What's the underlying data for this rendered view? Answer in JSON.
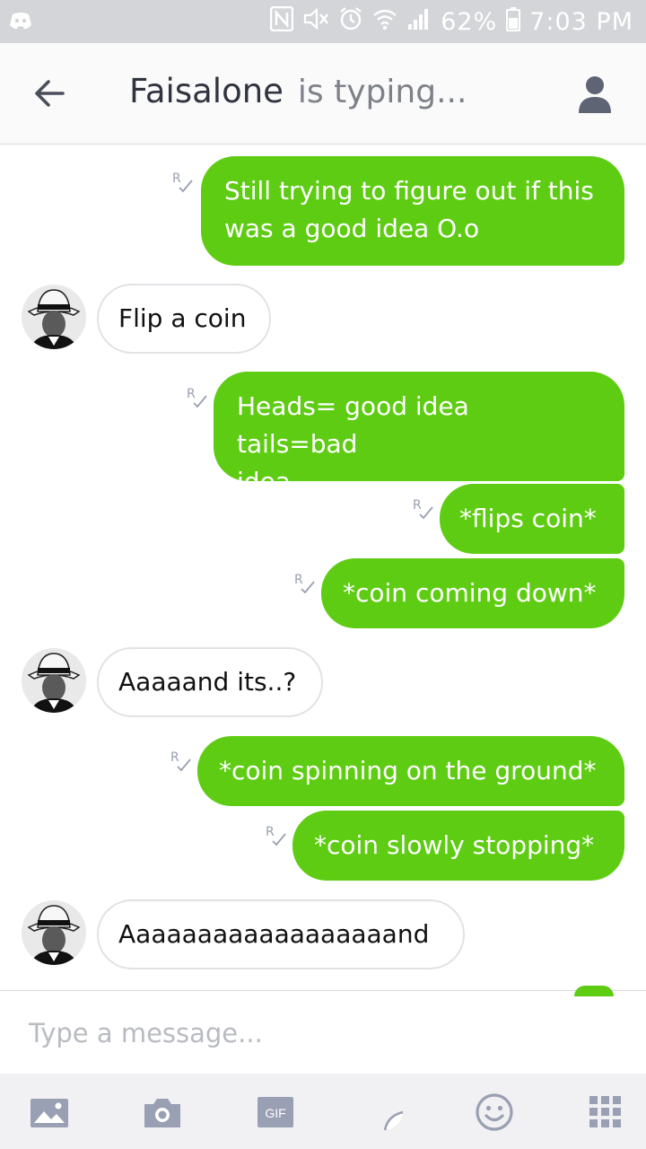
{
  "status_bar": {
    "battery": "62%",
    "time": "7:03 PM",
    "icons": [
      "discord-icon",
      "nfc-icon",
      "mute-icon",
      "alarm-icon",
      "wifi-icon",
      "signal-icon",
      "battery-icon"
    ]
  },
  "header": {
    "contact_name": "Faisalone",
    "status": "is typing...",
    "back_icon": "arrow-left-icon",
    "profile_icon": "person-icon"
  },
  "messages": [
    {
      "dir": "out",
      "line1": "Still trying to figure out if this",
      "line2": "was a good idea O.o",
      "read": "R"
    },
    {
      "dir": "in",
      "text": "Flip a coin"
    },
    {
      "dir": "out",
      "line1": "Heads= good idea tails=bad",
      "line2": "idea",
      "read": "R"
    },
    {
      "dir": "out",
      "text": "*flips coin*",
      "read": "R"
    },
    {
      "dir": "out",
      "text": "*coin coming down*",
      "read": "R"
    },
    {
      "dir": "in",
      "text": "Aaaaand its..?"
    },
    {
      "dir": "out",
      "text": "*coin spinning on the ground*",
      "read": "R"
    },
    {
      "dir": "out",
      "text": "*coin slowly stopping*",
      "read": "R"
    },
    {
      "dir": "in",
      "text": "Aaaaaaaaaaaaaaaaaand"
    }
  ],
  "composer": {
    "placeholder": "Type a message..."
  },
  "toolbar": {
    "gif_label": "GIF",
    "icons": [
      "gallery-icon",
      "camera-icon",
      "gif-icon",
      "sticker-icon",
      "smiley-icon",
      "apps-grid-icon"
    ]
  },
  "colors": {
    "outgoing_bubble": "#5fcc14",
    "incoming_border": "#e1e2e5",
    "status_bar": "#d4d5d8",
    "icon_gray": "#9aa0b3"
  }
}
